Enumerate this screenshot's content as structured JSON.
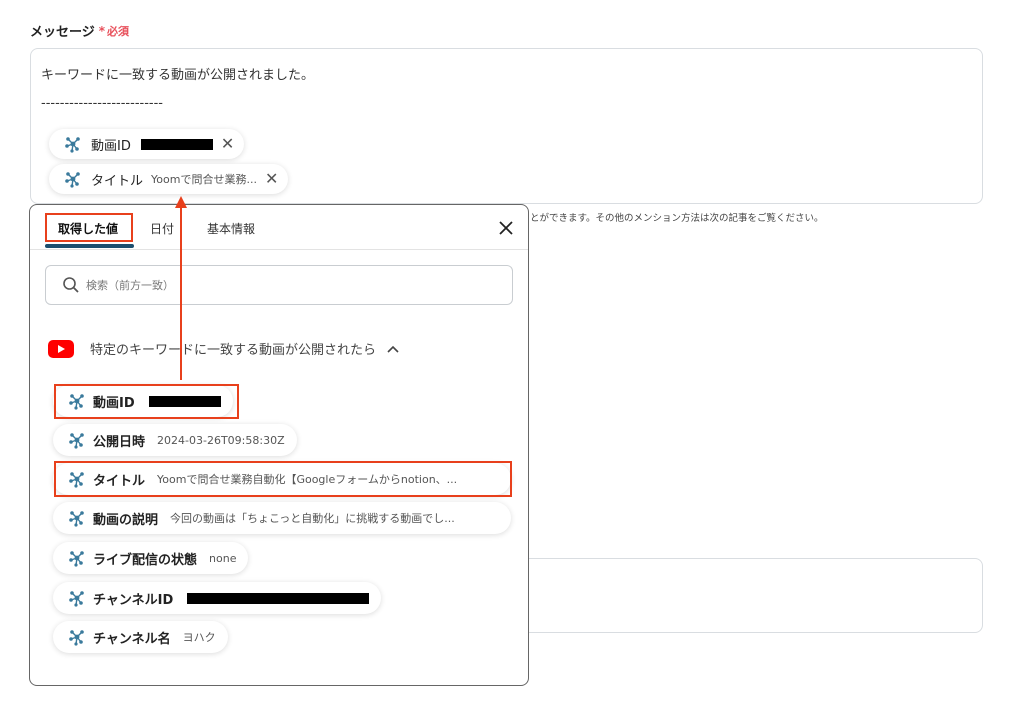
{
  "field": {
    "label": "メッセージ",
    "required_mark": "*",
    "required_text": "必須"
  },
  "message": {
    "line1": "キーワードに一致する動画が公開されました。",
    "line2": "--------------------------"
  },
  "chips": [
    {
      "label": "動画ID",
      "value": ""
    },
    {
      "label": "タイトル",
      "value": "Yoomで問合せ業務..."
    }
  ],
  "help_text": "とができます。その他のメンション方法は次の記事をご覧ください。",
  "popup": {
    "tabs": [
      "取得した値",
      "日付",
      "基本情報"
    ],
    "search_placeholder": "検索（前方一致）",
    "section_title": "特定のキーワードに一致する動画が公開されたら",
    "items": [
      {
        "label": "動画ID",
        "value": ""
      },
      {
        "label": "公開日時",
        "value": "2024-03-26T09:58:30Z"
      },
      {
        "label": "タイトル",
        "value": "Yoomで問合せ業務自動化【Googleフォームからnotion、..."
      },
      {
        "label": "動画の説明",
        "value": "今回の動画は「ちょこっと自動化」に挑戦する動画でし..."
      },
      {
        "label": "ライブ配信の状態",
        "value": "none"
      },
      {
        "label": "チャンネルID",
        "value": ""
      },
      {
        "label": "チャンネル名",
        "value": "ヨハク"
      }
    ]
  },
  "colors": {
    "accent": "#e8401c",
    "tab_underline": "#1c4e6e",
    "required": "#e8505b",
    "youtube": "#ff0000",
    "node_icon": "#3a7a9c"
  }
}
